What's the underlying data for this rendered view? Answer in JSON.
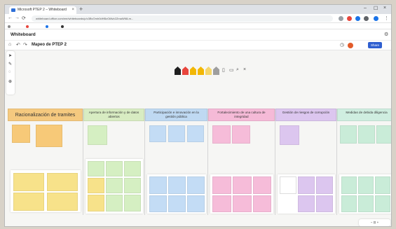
{
  "browser": {
    "tab_title": "Microsoft PTEP 2 – Whiteboard",
    "new_tab": "+",
    "close_tab": "×",
    "window_controls": [
      "–",
      "☐",
      "×"
    ],
    "url": "whiteboard.office.com/me/whiteboards/p/c3BvOmh0dHBzOi8vb2ZmaWNlLm..."
  },
  "app": {
    "title": "Whiteboard",
    "board_name": "Mapeo de PTEP 2",
    "share_label": "Share"
  },
  "toolbar": {
    "pen_colors": [
      "#1f1f1f",
      "#e8453c",
      "#f2b705",
      "#f2b705",
      "#f5d66a",
      "#9e9e9e"
    ]
  },
  "columns": [
    {
      "title": "Racionalización de tramites",
      "color": "#f5c97f"
    },
    {
      "title": "Apertura de información y de datos abiertos",
      "color": "#d8ecc2"
    },
    {
      "title": "Participación e innovación en la gestión pública",
      "color": "#bfd9f2"
    },
    {
      "title": "Fortalecimiento de una cultura de integridad",
      "color": "#f5bad7"
    },
    {
      "title": "Gestión de riesgos de corrupción",
      "color": "#dcc6ef"
    },
    {
      "title": "Medidas de debida diligencia",
      "color": "#cfeee0"
    }
  ],
  "colors": {
    "yellow_note": "#f7e28a",
    "orange_note": "#f7c978",
    "green_note": "#d5efc2",
    "blue_note": "#c3dcf5",
    "pink_note": "#f6bcd9",
    "purple_note": "#dcc6ef",
    "mint_note": "#c9ecd8"
  },
  "zoom": {
    "level": "Zoom"
  }
}
